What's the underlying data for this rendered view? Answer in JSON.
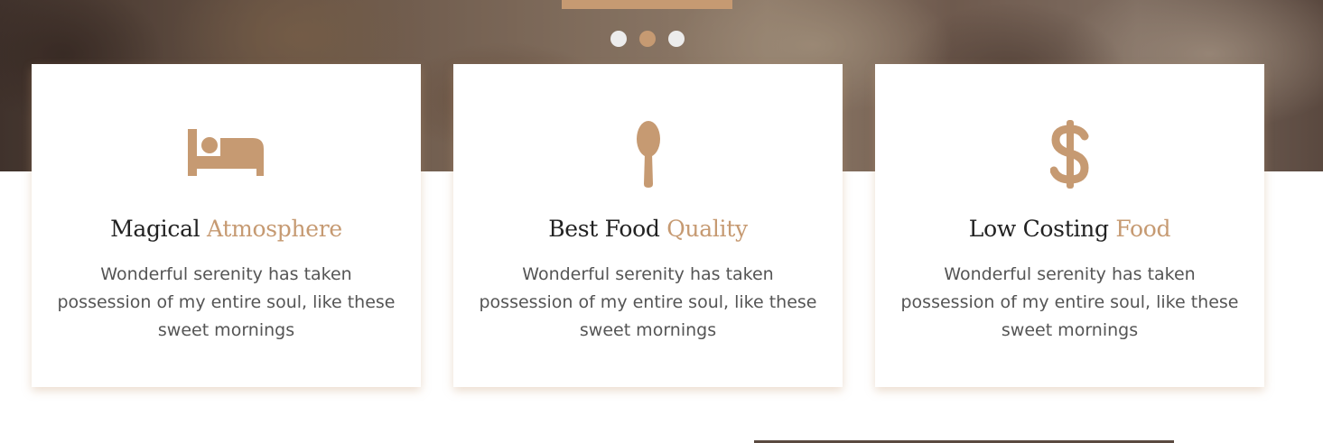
{
  "hero": {
    "slider_dots": [
      {
        "state": "inactive"
      },
      {
        "state": "active"
      },
      {
        "state": "inactive"
      }
    ]
  },
  "features": [
    {
      "icon": "bed-icon",
      "title_main": "Magical",
      "title_accent": "Atmosphere",
      "description": "Wonderful serenity has taken possession of my entire soul, like these sweet mornings"
    },
    {
      "icon": "spoon-icon",
      "title_main": "Best Food",
      "title_accent": "Quality",
      "description": "Wonderful serenity has taken possession of my entire soul, like these sweet mornings"
    },
    {
      "icon": "dollar-icon",
      "title_main": "Low Costing",
      "title_accent": "Food",
      "description": "Wonderful serenity has taken possession of my entire soul, like these sweet mornings"
    }
  ],
  "colors": {
    "accent": "#c69a72",
    "heading": "#222222",
    "body_text": "#555555",
    "dot_inactive": "#ececec"
  }
}
